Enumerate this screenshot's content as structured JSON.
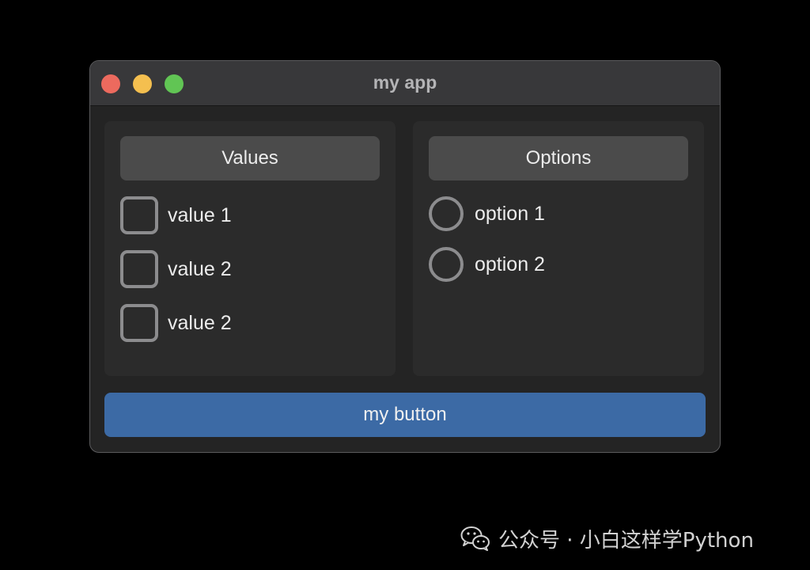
{
  "window": {
    "title": "my app",
    "controls": {
      "close_color": "#ec6a5e",
      "minimize_color": "#f4bf4f",
      "zoom_color": "#61c554"
    }
  },
  "values_panel": {
    "header": "Values",
    "items": [
      {
        "label": "value 1",
        "checked": false
      },
      {
        "label": "value 2",
        "checked": false
      },
      {
        "label": "value 2",
        "checked": false
      }
    ]
  },
  "options_panel": {
    "header": "Options",
    "items": [
      {
        "label": "option 1",
        "selected": false
      },
      {
        "label": "option 2",
        "selected": false
      }
    ]
  },
  "button": {
    "label": "my button",
    "color": "#3c6aa5"
  },
  "watermark": {
    "icon": "wechat-icon",
    "text": "公众号 · 小白这样学Python"
  }
}
